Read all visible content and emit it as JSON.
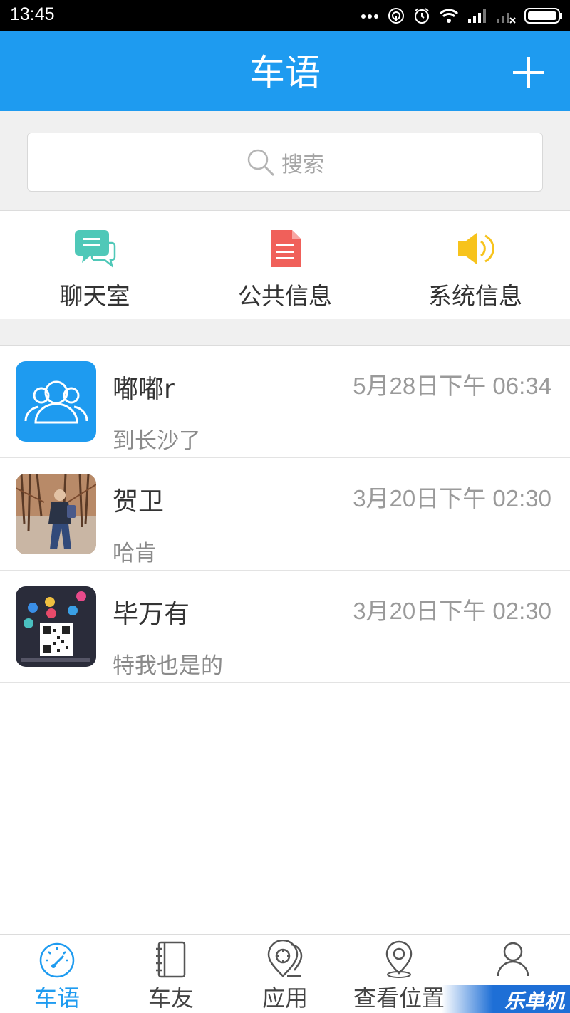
{
  "status_bar": {
    "time": "13:45"
  },
  "header": {
    "title": "车语"
  },
  "search": {
    "placeholder": "搜索"
  },
  "shortcuts": [
    {
      "label": "聊天室",
      "icon": "chat-bubble-icon",
      "color": "#4fc8b8"
    },
    {
      "label": "公共信息",
      "icon": "document-icon",
      "color": "#f0605a"
    },
    {
      "label": "系统信息",
      "icon": "speaker-icon",
      "color": "#f7c31c"
    }
  ],
  "chats": [
    {
      "name": "嘟嘟r",
      "time": "5月28日下午 06:34",
      "preview": "到长沙了",
      "avatar": "group-avatar"
    },
    {
      "name": "贺卫",
      "time": "3月20日下午 02:30",
      "preview": "哈肯",
      "avatar": "photo-avatar"
    },
    {
      "name": "毕万有",
      "time": "3月20日下午 02:30",
      "preview": "特我也是的",
      "avatar": "qr-avatar"
    }
  ],
  "bottom_nav": [
    {
      "label": "车语",
      "icon": "speedometer-icon",
      "active": true
    },
    {
      "label": "车友",
      "icon": "notebook-icon",
      "active": false
    },
    {
      "label": "应用",
      "icon": "location-apps-icon",
      "active": false
    },
    {
      "label": "查看位置",
      "icon": "map-pin-icon",
      "active": false
    },
    {
      "label": "",
      "icon": "person-icon",
      "active": false
    }
  ],
  "watermark": "乐单机",
  "colors": {
    "accent": "#1e9bf0",
    "background": "#f0f0f0"
  }
}
